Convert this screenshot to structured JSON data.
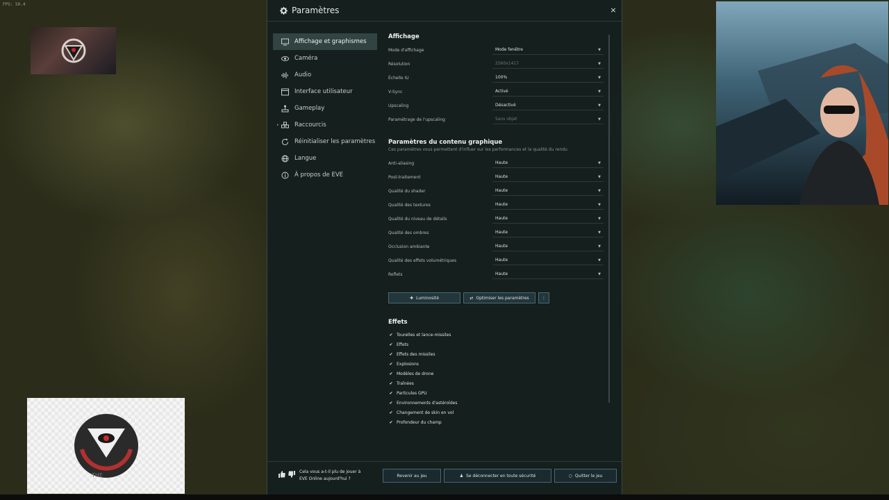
{
  "fps": "FPS: 50.4",
  "window": {
    "title": "Paramètres",
    "close_label": "×"
  },
  "sidebar": {
    "items": [
      {
        "label": "Affichage et graphismes",
        "icon": "monitor-icon",
        "active": true
      },
      {
        "label": "Caméra",
        "icon": "eye-icon"
      },
      {
        "label": "Audio",
        "icon": "audio-icon"
      },
      {
        "label": "Interface utilisateur",
        "icon": "window-icon"
      },
      {
        "label": "Gameplay",
        "icon": "joystick-icon"
      },
      {
        "label": "Raccourcis",
        "icon": "keyboard-icon",
        "expander": "▸"
      },
      {
        "label": "Réinitialiser les paramètres",
        "icon": "reset-icon"
      },
      {
        "label": "Langue",
        "icon": "globe-icon"
      },
      {
        "label": "À propos de EVE",
        "icon": "info-icon"
      }
    ]
  },
  "display": {
    "title": "Affichage",
    "rows": [
      {
        "label": "Mode d'affichage",
        "value": "Mode fenêtre"
      },
      {
        "label": "Résolution",
        "value": "2560x1417",
        "disabled": true
      },
      {
        "label": "Échelle IU",
        "value": "100%"
      },
      {
        "label": "V-Sync",
        "value": "Activé"
      },
      {
        "label": "Upscaling",
        "value": "Désactivé"
      },
      {
        "label": "Paramétrage de l'upscaling",
        "value": "Sans objet",
        "disabled": true
      }
    ]
  },
  "graphics": {
    "title": "Paramètres du contenu graphique",
    "subtitle": "Ces paramètres vous permettent d'influer sur les performances et la qualité du rendu",
    "rows": [
      {
        "label": "Anti-aliasing",
        "value": "Haute"
      },
      {
        "label": "Post-traitement",
        "value": "Haute"
      },
      {
        "label": "Qualité du shader",
        "value": "Haute"
      },
      {
        "label": "Qualité des textures",
        "value": "Haute"
      },
      {
        "label": "Qualité du niveau de détails",
        "value": "Haute"
      },
      {
        "label": "Qualité des ombres",
        "value": "Haute"
      },
      {
        "label": "Occlusion ambiante",
        "value": "Haute"
      },
      {
        "label": "Qualité des effets volumétriques",
        "value": "Haute"
      },
      {
        "label": "Reflets",
        "value": "Haute"
      }
    ],
    "brightness_label": "Luminosité",
    "optimize_label": "Optimiser les paramètres",
    "more_label": "⋮"
  },
  "effects": {
    "title": "Effets",
    "items": [
      "Tourelles et lance-missiles",
      "Effets",
      "Effets des missiles",
      "Explosions",
      "Modèles de drone",
      "Traînées",
      "Particules GPU",
      "Environnements d'astéroïdes",
      "Changement de skin en vol",
      "Profondeur du champ"
    ],
    "check_glyph": "✔"
  },
  "footer": {
    "feedback_line1": "Cela vous a-t-il plu de jouer à",
    "feedback_line2": "EVE Online aujourd'hui ?",
    "return_label": "Revenir au jeu",
    "logout_label": "Se déconnecter en toute sécurité",
    "quit_label": "Quitter le jeu"
  },
  "overlay_bl_text": "THE"
}
